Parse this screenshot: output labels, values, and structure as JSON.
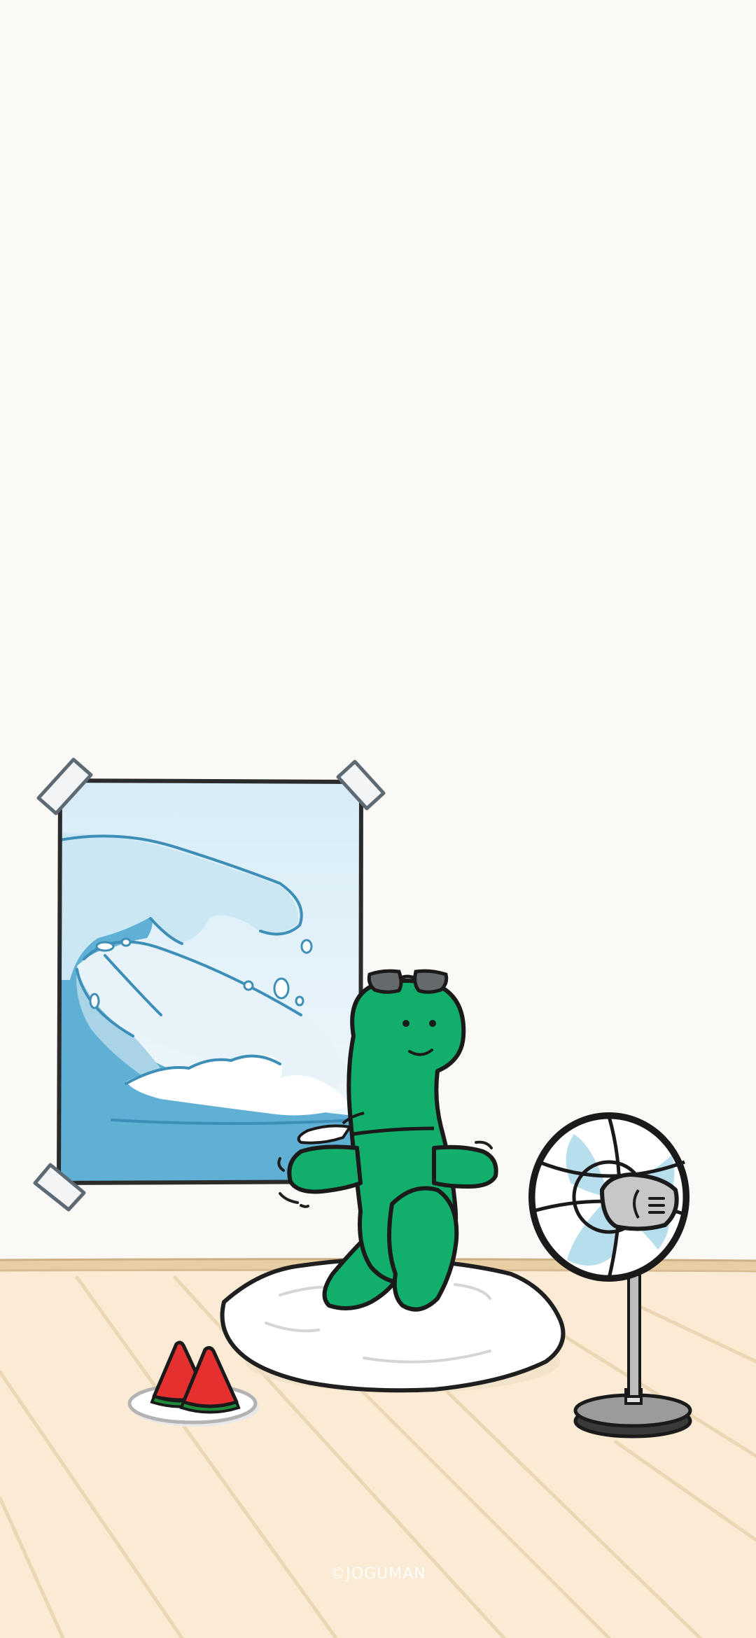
{
  "credit": "©JOGUMAN",
  "icons": {
    "poster": "wave-poster-icon",
    "character": "green-dino-character-icon",
    "sunglasses": "sunglasses-icon",
    "fan": "electric-fan-icon",
    "watermelon": "watermelon-slices-icon",
    "cushion": "floor-cushion-icon"
  },
  "colors": {
    "wall": "#fbf9f5",
    "floor": "#fbebd4",
    "baseboard": "#e8cfa3",
    "character": "#12ae6c",
    "outline": "#222222",
    "wave_dark": "#5fb0d4",
    "wave_light": "#cbe7f3",
    "watermelon": "#e63030"
  }
}
